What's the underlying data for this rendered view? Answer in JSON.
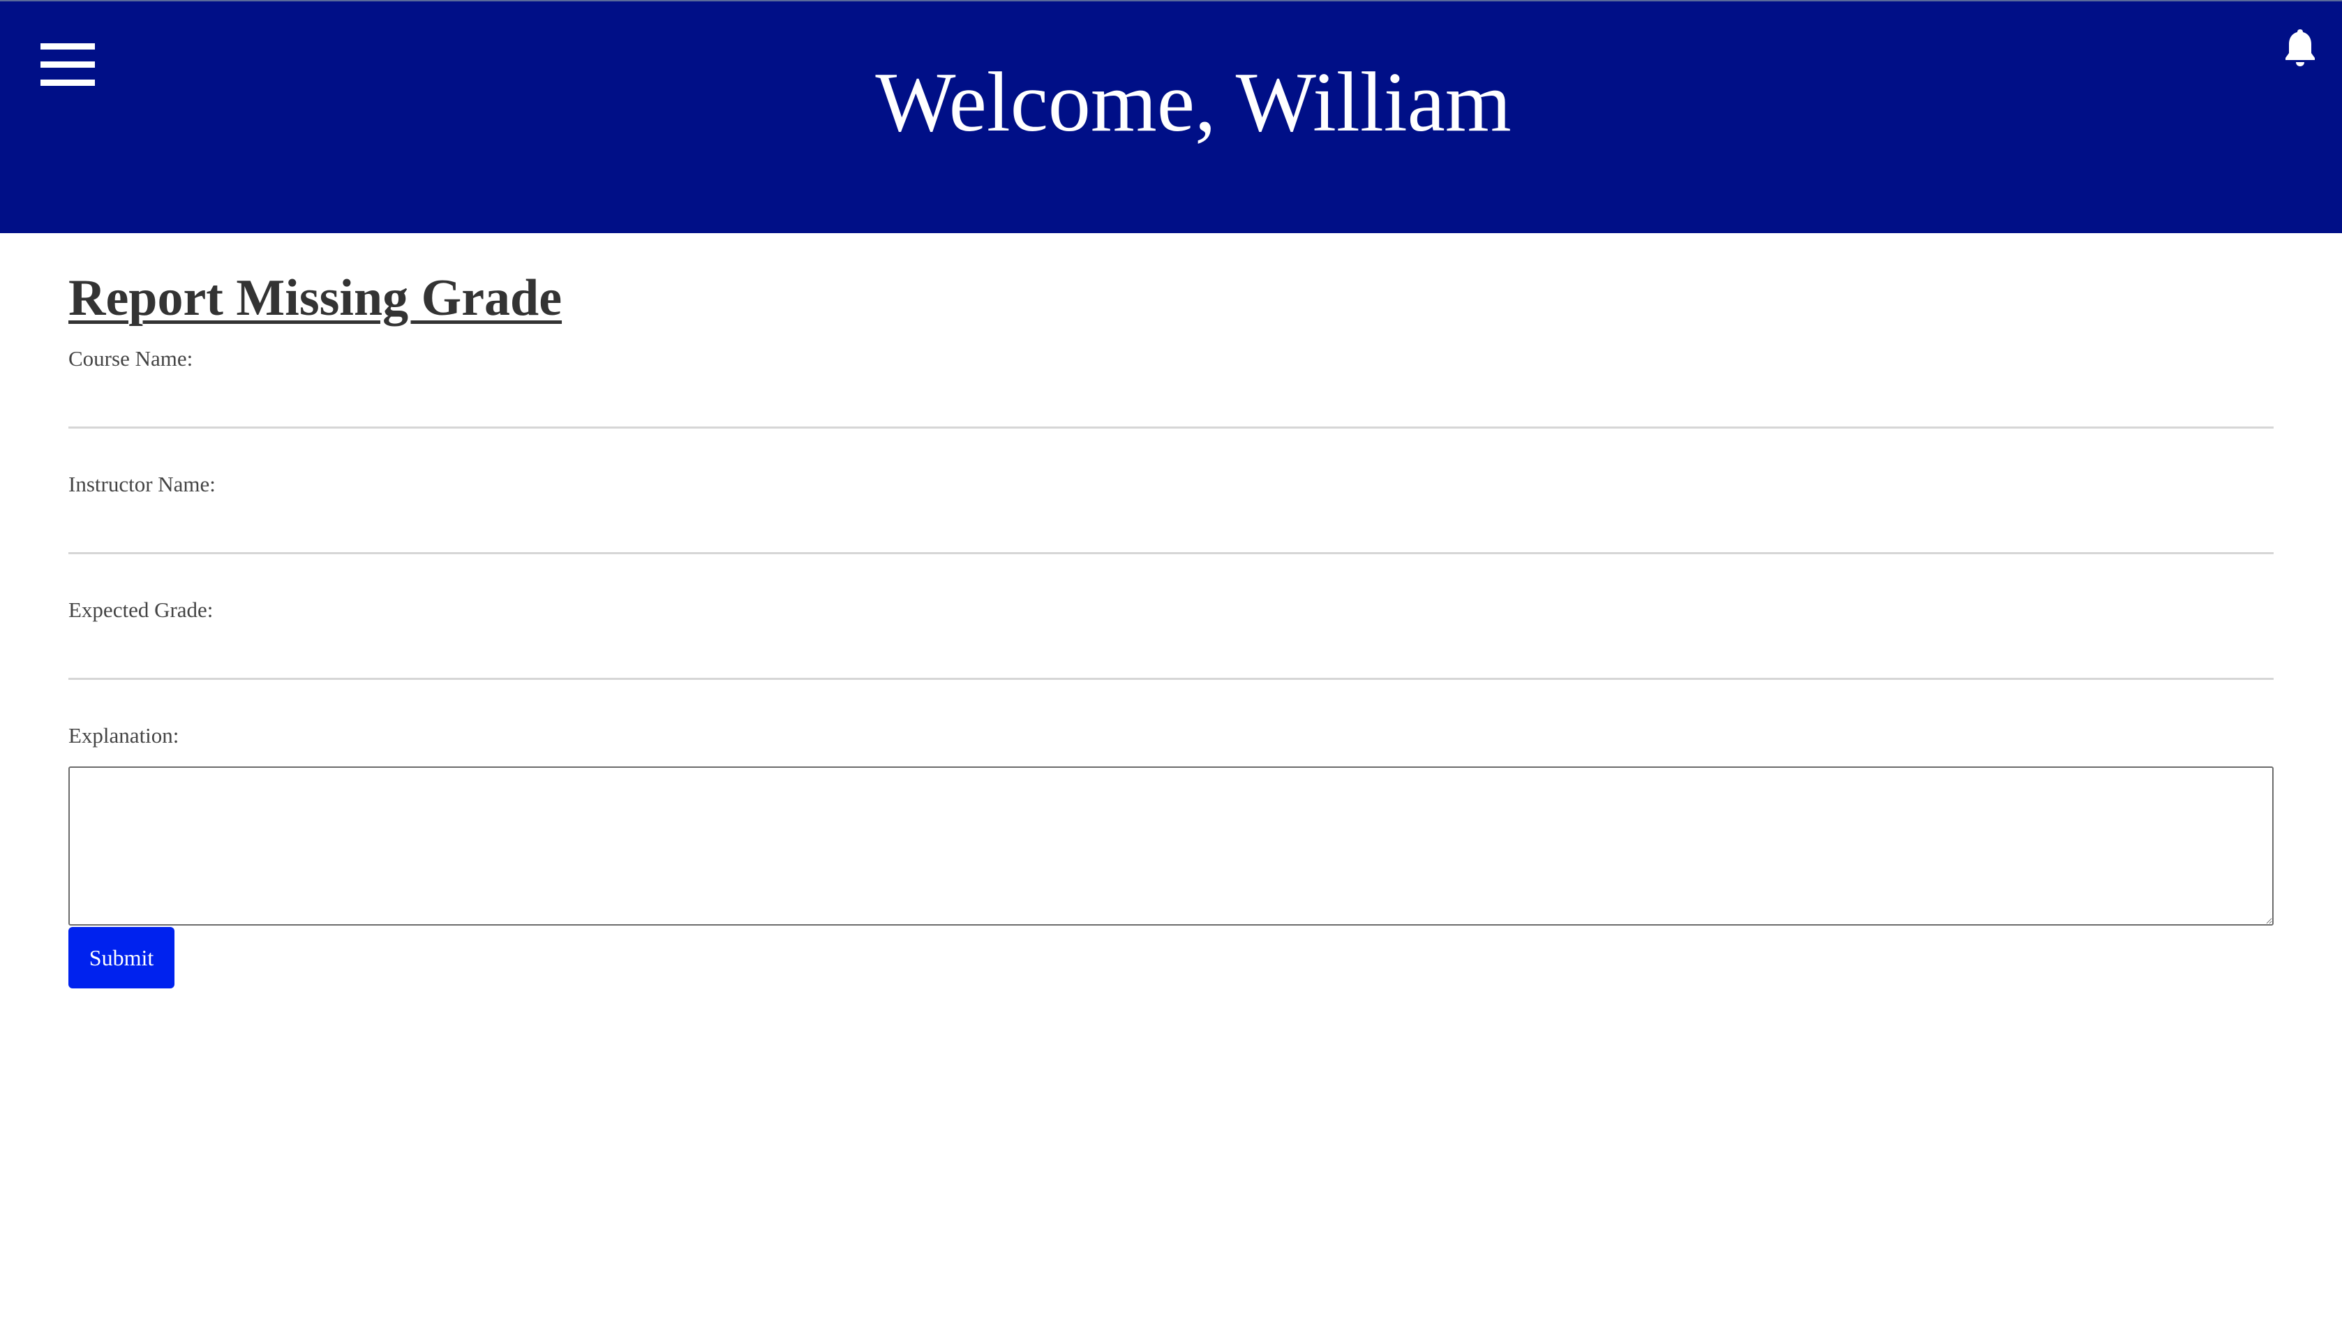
{
  "header": {
    "title": "Welcome, William",
    "menu_icon": "hamburger-menu-icon",
    "notification_icon": "bell-icon",
    "background_color": "#000f87"
  },
  "form": {
    "title": "Report Missing Grade",
    "fields": [
      {
        "label": "Course Name:",
        "value": "",
        "placeholder": ""
      },
      {
        "label": "Instructor Name:",
        "value": "",
        "placeholder": ""
      },
      {
        "label": "Expected Grade:",
        "value": "",
        "placeholder": ""
      }
    ],
    "explanation": {
      "label": "Explanation:",
      "value": ""
    },
    "submit_label": "Submit",
    "submit_color": "#0022ee"
  }
}
